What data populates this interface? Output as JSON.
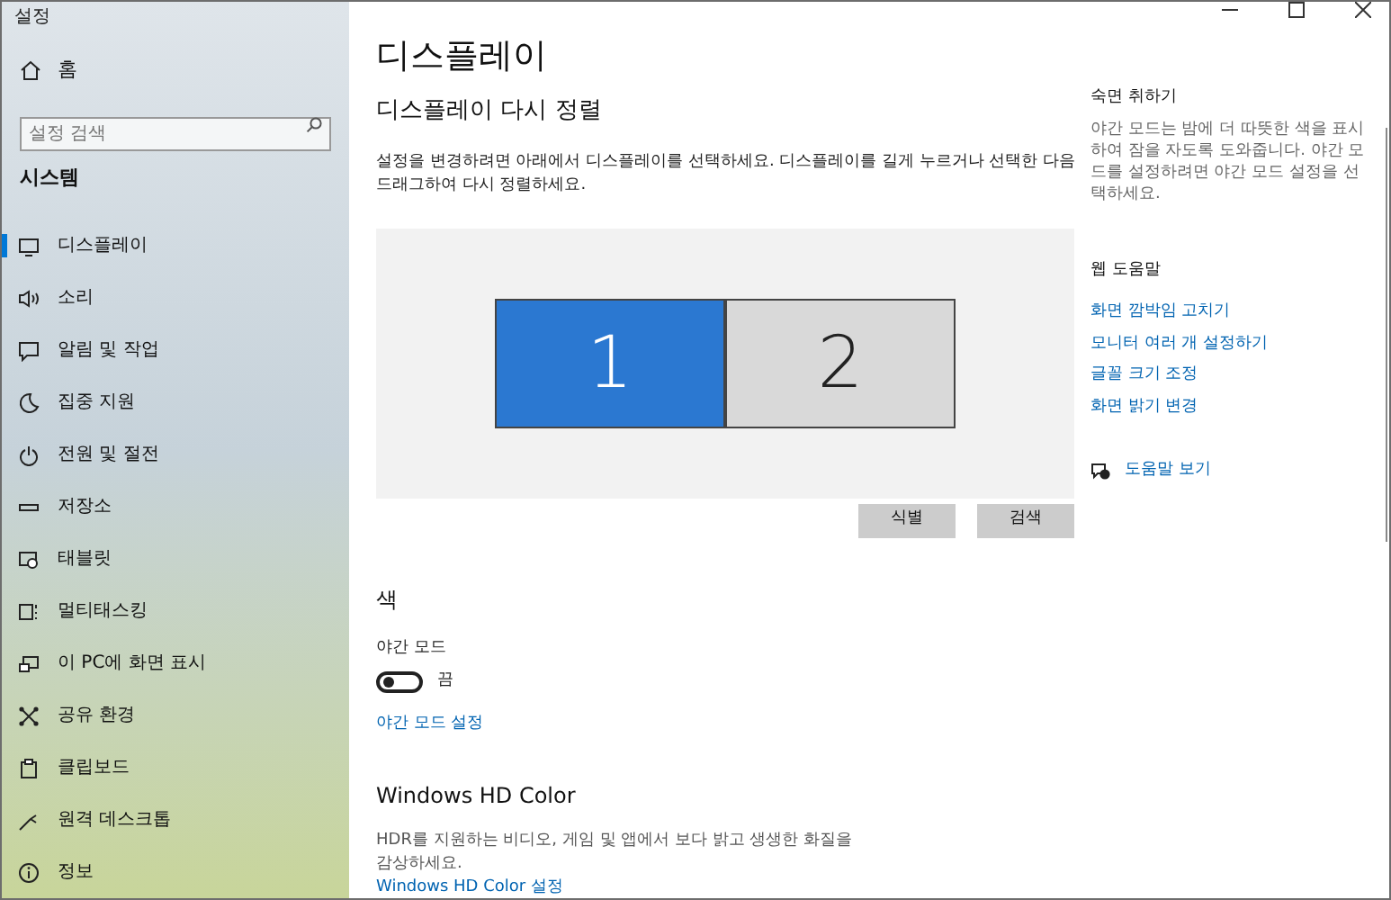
{
  "window": {
    "title": "설정"
  },
  "sidebar": {
    "home": "홈",
    "search": {
      "placeholder": "설정 검색"
    },
    "section": "시스템",
    "items": [
      {
        "label": "디스플레이",
        "selected": true
      },
      {
        "label": "소리",
        "selected": false
      },
      {
        "label": "알림 및 작업",
        "selected": false
      },
      {
        "label": "집중 지원",
        "selected": false
      },
      {
        "label": "전원 및 절전",
        "selected": false
      },
      {
        "label": "저장소",
        "selected": false
      },
      {
        "label": "태블릿",
        "selected": false
      },
      {
        "label": "멀티태스킹",
        "selected": false
      },
      {
        "label": "이 PC에 화면 표시",
        "selected": false
      },
      {
        "label": "공유 환경",
        "selected": false
      },
      {
        "label": "클립보드",
        "selected": false
      },
      {
        "label": "원격 데스크톱",
        "selected": false
      },
      {
        "label": "정보",
        "selected": false
      }
    ]
  },
  "main": {
    "title": "디스플레이",
    "subtitle": "디스플레이 다시 정렬",
    "description": "설정을 변경하려면 아래에서 디스플레이를 선택하세요. 디스플레이를 길게 누르거나 선택한 다음 드래그하여 다시 정렬하세요.",
    "displays": [
      {
        "label": "1",
        "selected": true
      },
      {
        "label": "2",
        "selected": false
      }
    ],
    "buttons": [
      "식별",
      "검색"
    ],
    "color_heading": "색",
    "night_light": {
      "label": "야간 모드",
      "on": false,
      "state_text": "끔"
    },
    "night_link": "야간 모드 설정",
    "hd_heading": "Windows HD Color",
    "hd_description": "HDR를 지원하는 비디오, 게임 및 앱에서 보다 밝고 생생한 화질을 감상하세요.",
    "hd_link": "Windows HD Color 설정"
  },
  "aside": {
    "heading": "숙면 취하기",
    "text": "야간 모드는 밤에 더 따뜻한 색을 표시하여 잠을 자도록 도와줍니다. 야간 모드를 설정하려면 야간 모드 설정을 선택하세요.",
    "help_heading": "웹 도움말",
    "links": [
      "화면 깜박임 고치기",
      "모니터 여러 개 설정하기",
      "글꼴 크기 조정",
      "화면 밝기 변경"
    ],
    "get_help": "도움말 보기"
  }
}
